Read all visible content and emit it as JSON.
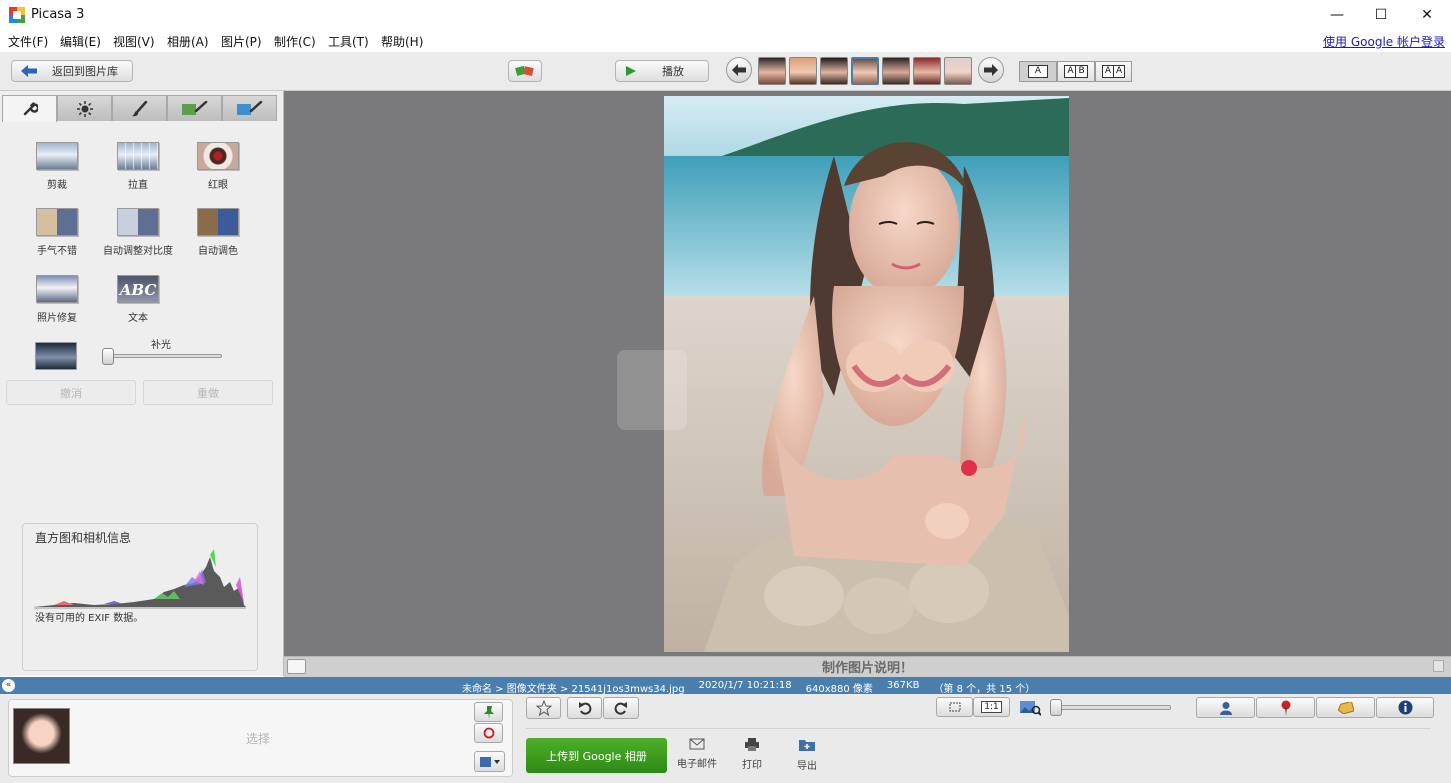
{
  "window": {
    "title": "Picasa 3",
    "minimize": "—",
    "maximize": "☐",
    "close": "✕"
  },
  "menu": [
    "文件(F)",
    "编辑(E)",
    "视图(V)",
    "相册(A)",
    "图片(P)",
    "制作(C)",
    "工具(T)",
    "帮助(H)"
  ],
  "login_link": "使用 Google 帐户登录",
  "toolbar": {
    "back_label": "返回到图片库",
    "play_label": "播放",
    "layout_a": "A",
    "layout_ab_1": "A",
    "layout_ab_2": "B",
    "layout_aa_1": "A",
    "layout_aa_2": "A"
  },
  "tools": {
    "crop": "剪裁",
    "straighten": "拉直",
    "redeye": "红眼",
    "feeling_lucky": "手气不错",
    "auto_contrast": "自动调整对比度",
    "auto_color": "自动调色",
    "retouch": "照片修复",
    "text": "文本"
  },
  "fill_light": {
    "label": "补光",
    "value": 0
  },
  "undo_label": "撤消",
  "redo_label": "重做",
  "histogram": {
    "title": "直方图和相机信息",
    "exif_text": "没有可用的 EXIF 数据。"
  },
  "caption_placeholder": "制作图片说明！",
  "statusbar": {
    "path": "未命名 > 图像文件夹 > 21541j1os3mws34.jpg",
    "date": "2020/1/7 10:21:18",
    "dimensions": "640x880 像素",
    "size": "367KB",
    "position": "（第 8 个，共 15 个）"
  },
  "tray": {
    "select_label": "选择"
  },
  "upload_label": "上传到 Google 相册",
  "actions": {
    "email": "电子邮件",
    "print": "打印",
    "export": "导出"
  },
  "zoom_btns": {
    "fit": "",
    "one_to_one": "1:1"
  },
  "colors": {
    "accent_green": "#3d9a1f",
    "status_blue": "#4a7fad",
    "viewer_gray": "#7a797b",
    "link": "#1b1bb5"
  },
  "icons": [
    "picasa-logo-icon",
    "back-arrow-icon",
    "collage-icon",
    "play-icon",
    "prev-arrow-icon",
    "next-arrow-icon",
    "wrench-icon",
    "sun-icon",
    "brush-icon",
    "star-icon",
    "rotate-left-icon",
    "rotate-right-icon",
    "pin-icon",
    "person-icon",
    "map-pin-icon",
    "tag-icon",
    "info-icon",
    "email-icon",
    "print-icon",
    "export-icon"
  ]
}
